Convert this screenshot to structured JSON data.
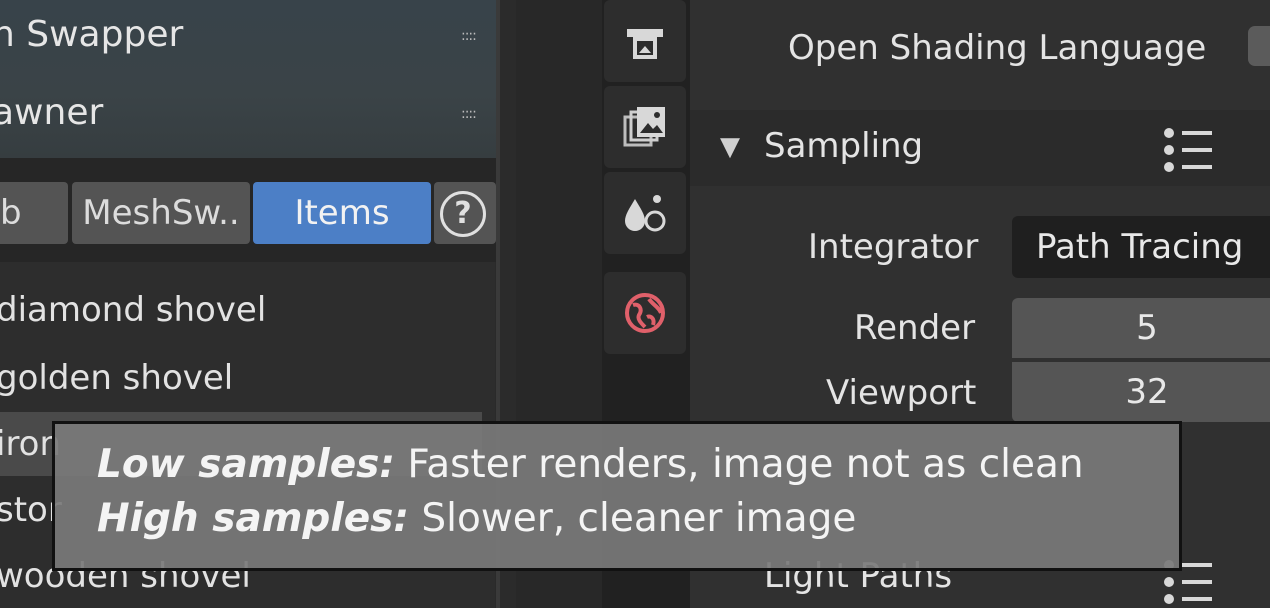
{
  "left_panel": {
    "addons": [
      {
        "label": "n Swapper",
        "grip": "::::"
      },
      {
        "label": "awner",
        "grip": "::::"
      }
    ],
    "tabs": [
      {
        "label": "b",
        "active": false
      },
      {
        "label": "MeshSw..",
        "active": false
      },
      {
        "label": "Items",
        "active": true
      }
    ],
    "help_icon": "?",
    "items": [
      "diamond shovel",
      "golden shovel",
      "iron",
      "stor",
      "wooden shovel"
    ]
  },
  "property_tabs": [
    {
      "icon": "printer-icon"
    },
    {
      "icon": "image-stack-icon"
    },
    {
      "icon": "physics-drops-icon"
    },
    {
      "icon": "world-icon",
      "color": "#e0606a"
    }
  ],
  "properties": {
    "osl_label": "Open Shading Language",
    "sampling": {
      "title": "Sampling"
    },
    "integrator": {
      "label": "Integrator",
      "value": "Path Tracing"
    },
    "render": {
      "label": "Render",
      "value": "5"
    },
    "viewport": {
      "label": "Viewport",
      "value": "32"
    },
    "light_paths": {
      "title": "Light Paths"
    }
  },
  "caption": {
    "line1_bold": "Low samples:",
    "line1_text": " Faster renders, image not as clean",
    "line2_bold": "High samples:",
    "line2_text": " Slower, cleaner image"
  },
  "colors": {
    "accent": "#4c7fc6",
    "world_icon": "#e0606a"
  }
}
